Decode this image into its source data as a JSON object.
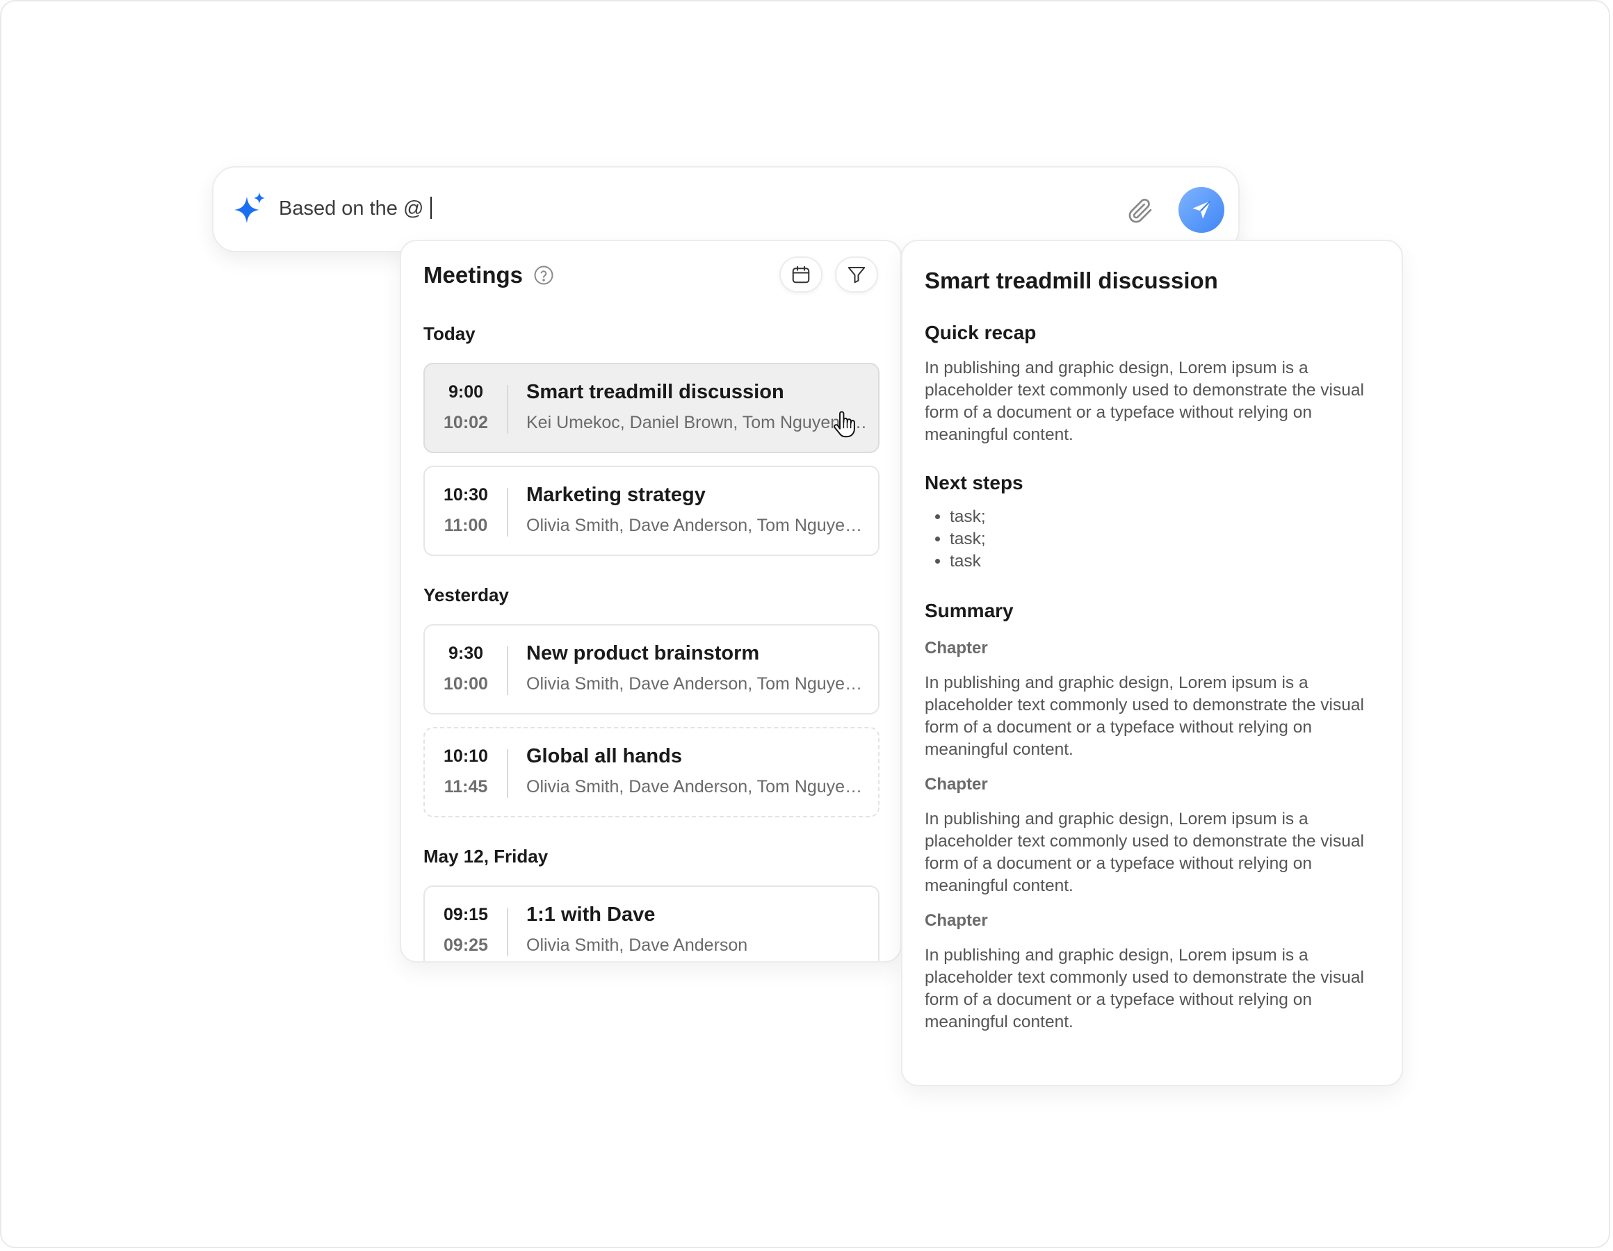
{
  "composer": {
    "text": "Based on the @ ",
    "icons": {
      "ai": "sparkle-icon",
      "attach": "paperclip-icon",
      "send": "send-icon"
    },
    "accent": "#1a6ff2"
  },
  "meetings": {
    "title": "Meetings",
    "sections": [
      {
        "label": "Today",
        "items": [
          {
            "start": "9:00",
            "end": "10:02",
            "title": "Smart treadmill discussion",
            "attendees": "Kei Umekoc, Daniel Brown, Tom Nguyen, Olivia Smith"
          },
          {
            "start": "10:30",
            "end": "11:00",
            "title": "Marketing strategy",
            "attendees": "Olivia Smith, Dave Anderson, Tom Nguyen, Kei Umekoc"
          }
        ]
      },
      {
        "label": "Yesterday",
        "items": [
          {
            "start": "9:30",
            "end": "10:00",
            "title": "New product brainstorm",
            "attendees": "Olivia Smith, Dave Anderson, Tom Nguyen, Kei Umekoc"
          },
          {
            "start": "10:10",
            "end": "11:45",
            "title": "Global all hands",
            "attendees": "Olivia Smith, Dave Anderson, Tom Nguyen, Kei Umekoc"
          }
        ]
      },
      {
        "label": "May 12, Friday",
        "items": [
          {
            "start": "09:15",
            "end": "09:25",
            "title": "1:1 with Dave",
            "attendees": "Olivia Smith, Dave Anderson"
          }
        ]
      }
    ]
  },
  "detail": {
    "title": "Smart treadmill discussion",
    "quick_recap_heading": "Quick recap",
    "quick_recap_text": "In publishing and graphic design, Lorem ipsum is a placeholder text commonly used to demonstrate the visual form of a document or a typeface without relying on meaningful content.",
    "next_steps_heading": "Next steps",
    "next_steps": [
      "task;",
      "task;",
      "task"
    ],
    "summary_heading": "Summary",
    "chapters": [
      {
        "label": "Chapter",
        "text": "In publishing and graphic design, Lorem ipsum is a placeholder text commonly used to demonstrate the visual form of a document or a typeface without relying on meaningful content."
      },
      {
        "label": "Chapter",
        "text": "In publishing and graphic design, Lorem ipsum is a placeholder text commonly used to demonstrate the visual form of a document or a typeface without relying on meaningful content."
      },
      {
        "label": "Chapter",
        "text": "In publishing and graphic design, Lorem ipsum is a placeholder text commonly used to demonstrate the visual form of a document or a typeface without relying on meaningful content."
      }
    ]
  }
}
